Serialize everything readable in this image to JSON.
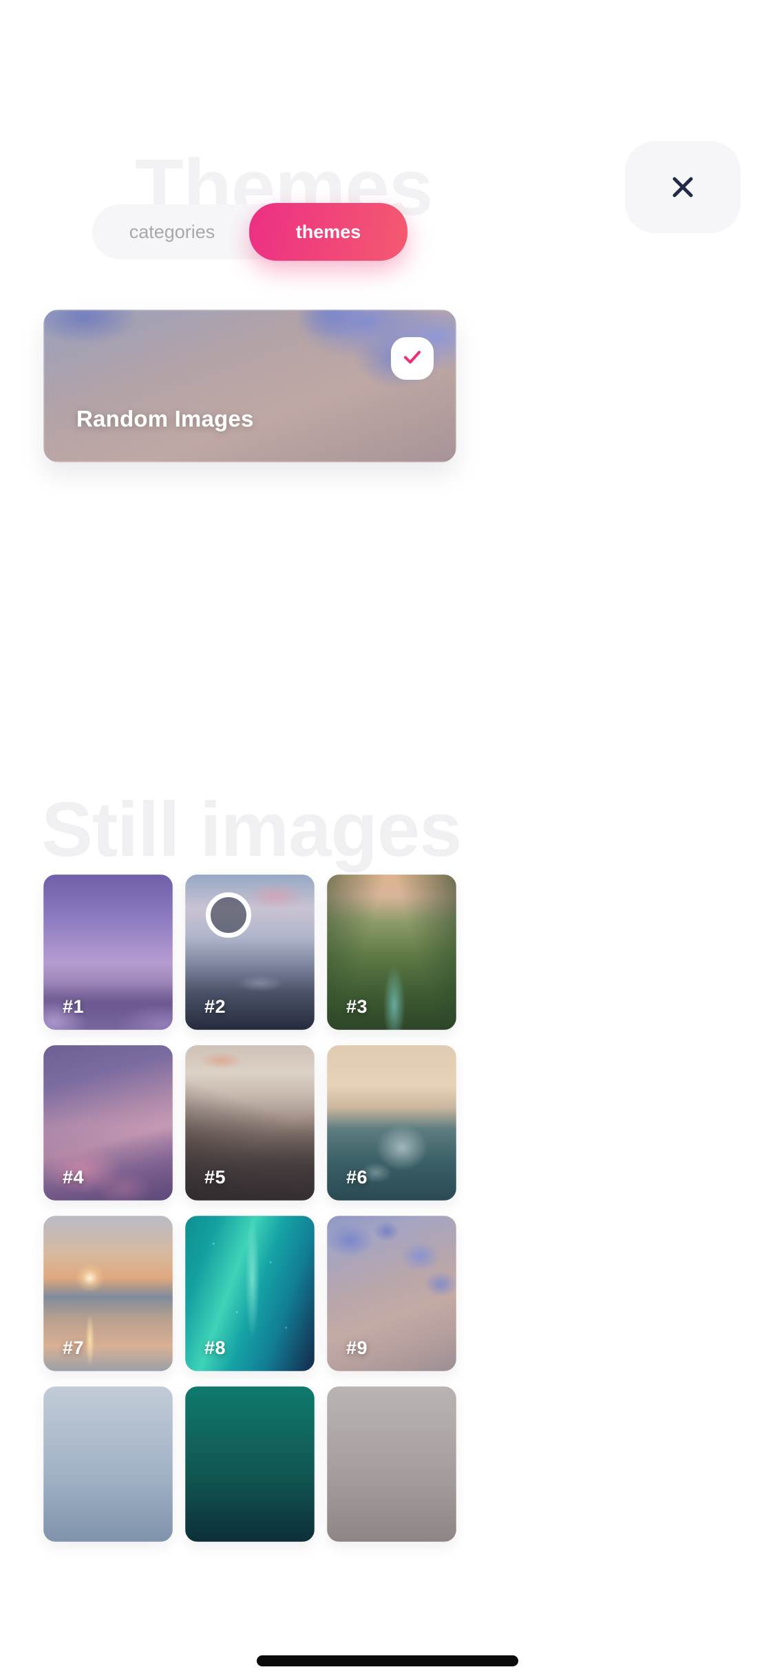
{
  "header": {
    "ghost_title": "Themes",
    "close_icon": "close-icon",
    "close_label": "Close"
  },
  "segment": {
    "options": [
      {
        "label": "categories",
        "active": false
      },
      {
        "label": "themes",
        "active": true
      }
    ],
    "active_color": "#ec2f84",
    "active_color_end": "#f45a6f",
    "inactive_text_color": "#a8a8ad",
    "track_color": "#f6f6f8"
  },
  "banner": {
    "title": "Random Images",
    "selected": true,
    "check_icon": "check-icon",
    "check_color": "#ed2d78"
  },
  "section": {
    "ghost_heading": "Still images"
  },
  "grid": {
    "tiles": [
      {
        "label": "#1",
        "loading": false
      },
      {
        "label": "#2",
        "loading": true
      },
      {
        "label": "#3",
        "loading": false
      },
      {
        "label": "#4",
        "loading": false
      },
      {
        "label": "#5",
        "loading": false
      },
      {
        "label": "#6",
        "loading": false
      },
      {
        "label": "#7",
        "loading": false
      },
      {
        "label": "#8",
        "loading": false
      },
      {
        "label": "#9",
        "loading": false
      },
      {
        "label": "",
        "loading": false
      },
      {
        "label": "",
        "loading": false
      },
      {
        "label": "",
        "loading": false
      }
    ]
  },
  "system": {
    "home_indicator": "home-indicator"
  }
}
